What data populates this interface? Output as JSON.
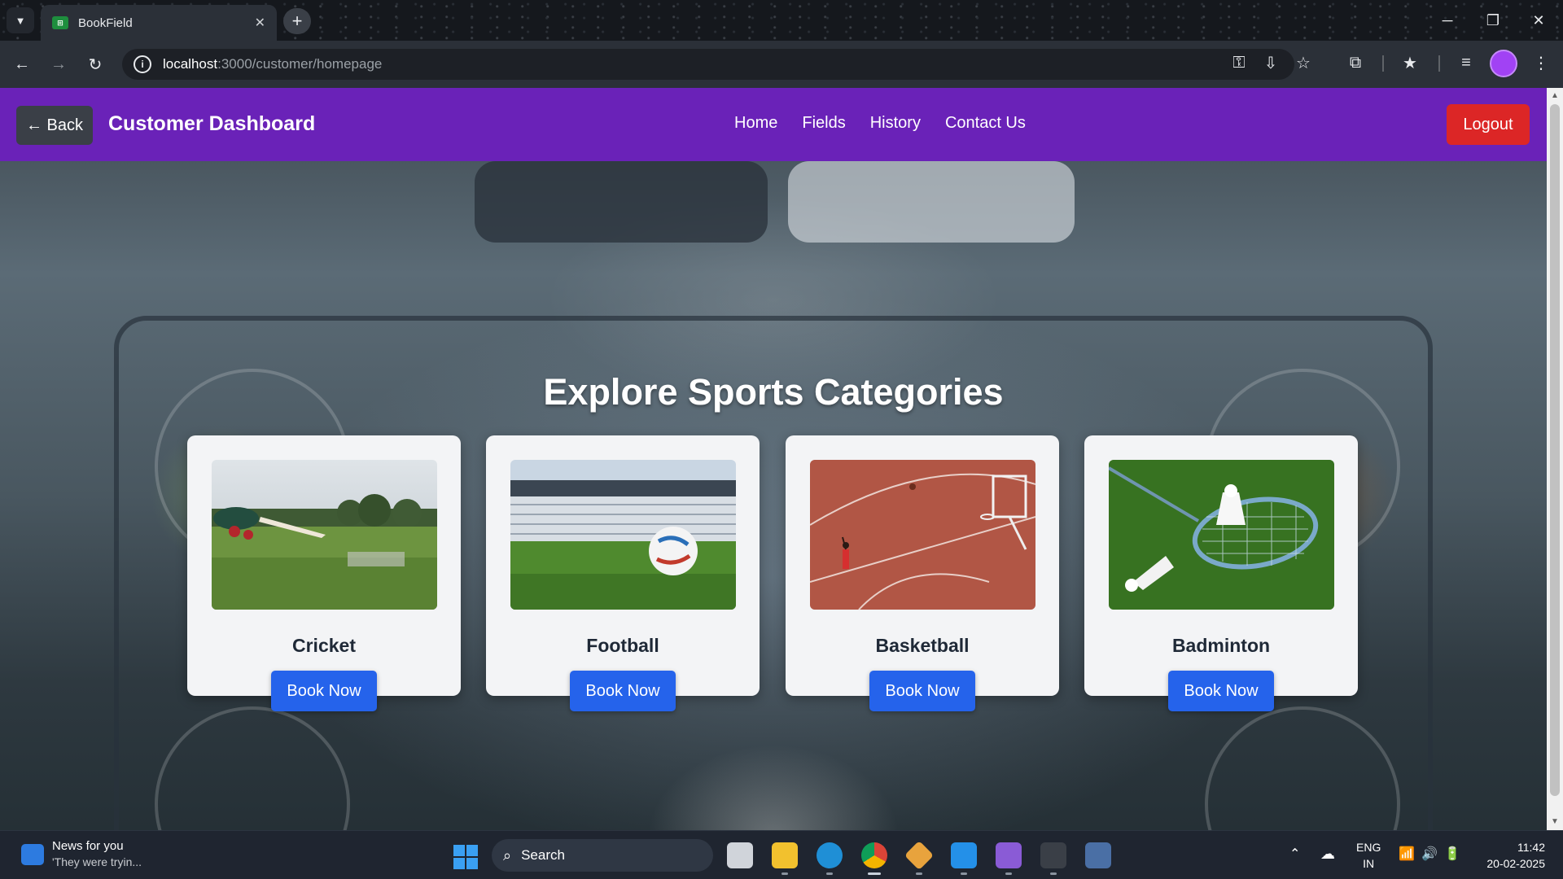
{
  "browser": {
    "tab_title": "BookField",
    "tab_favicon": "sheet-icon",
    "url_host": "localhost",
    "url_path": ":3000/customer/homepage"
  },
  "header": {
    "back_label": "← Back",
    "title": "Customer Dashboard",
    "nav": [
      "Home",
      "Fields",
      "History",
      "Contact Us"
    ],
    "logout_label": "Logout",
    "colors": {
      "header_bg": "#6a22b8",
      "logout_bg": "#dc2626",
      "book_bg": "#2563eb"
    }
  },
  "main": {
    "heading": "Explore Sports Categories",
    "categories": [
      {
        "name": "Cricket",
        "button": "Book Now"
      },
      {
        "name": "Football",
        "button": "Book Now"
      },
      {
        "name": "Basketball",
        "button": "Book Now"
      },
      {
        "name": "Badminton",
        "button": "Book Now"
      }
    ]
  },
  "taskbar": {
    "news_title": "News for you",
    "news_sub": "'They were tryin...",
    "search_label": "Search",
    "lang_top": "ENG",
    "lang_bottom": "IN",
    "time": "11:42",
    "date": "20-02-2025"
  }
}
